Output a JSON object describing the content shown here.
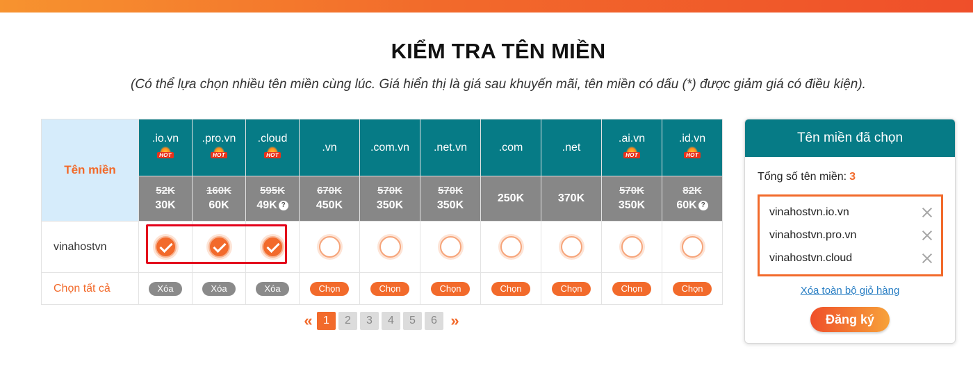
{
  "header": {
    "title": "KIỂM TRA TÊN MIỀN",
    "subtitle": "(Có thể lựa chọn nhiều tên miền cùng lúc. Giá hiển thị là giá sau khuyến mãi, tên miền có dấu (*) được giảm giá có điều kiện)."
  },
  "table": {
    "corner_label": "Tên miền",
    "hot_label": "HOT",
    "help_icon": "question-circle-icon",
    "tlds": [
      {
        "name": ".io.vn",
        "hot": true,
        "old_price": "52K",
        "price": "30K",
        "help": false,
        "checked": true,
        "action": "Xóa"
      },
      {
        "name": ".pro.vn",
        "hot": true,
        "old_price": "160K",
        "price": "60K",
        "help": false,
        "checked": true,
        "action": "Xóa"
      },
      {
        "name": ".cloud",
        "hot": true,
        "old_price": "595K",
        "price": "49K",
        "help": true,
        "checked": true,
        "action": "Xóa"
      },
      {
        "name": ".vn",
        "hot": false,
        "old_price": "670K",
        "price": "450K",
        "help": false,
        "checked": false,
        "action": "Chọn"
      },
      {
        "name": ".com.vn",
        "hot": false,
        "old_price": "570K",
        "price": "350K",
        "help": false,
        "checked": false,
        "action": "Chọn"
      },
      {
        "name": ".net.vn",
        "hot": false,
        "old_price": "570K",
        "price": "350K",
        "help": false,
        "checked": false,
        "action": "Chọn"
      },
      {
        "name": ".com",
        "hot": false,
        "old_price": "",
        "price": "250K",
        "help": false,
        "checked": false,
        "action": "Chọn"
      },
      {
        "name": ".net",
        "hot": false,
        "old_price": "",
        "price": "370K",
        "help": false,
        "checked": false,
        "action": "Chọn"
      },
      {
        "name": ".ai.vn",
        "hot": true,
        "old_price": "570K",
        "price": "350K",
        "help": false,
        "checked": false,
        "action": "Chọn"
      },
      {
        "name": ".id.vn",
        "hot": true,
        "old_price": "82K",
        "price": "60K",
        "help": true,
        "checked": false,
        "action": "Chọn"
      }
    ],
    "domain_name": "vinahostvn",
    "select_all_label": "Chọn tất cả"
  },
  "pagination": {
    "prev": "«",
    "next": "»",
    "pages": [
      "1",
      "2",
      "3",
      "4",
      "5",
      "6"
    ],
    "active": "1"
  },
  "cart": {
    "title": "Tên miền đã chọn",
    "total_label": "Tổng số tên miền:",
    "total_count": "3",
    "items": [
      "vinahostvn.io.vn",
      "vinahostvn.pro.vn",
      "vinahostvn.cloud"
    ],
    "clear_label": "Xóa toàn bộ giỏ hàng",
    "register_label": "Đăng ký"
  },
  "colors": {
    "accent": "#f26a2b",
    "header_teal": "#067b86",
    "price_gray": "#878787",
    "highlight_red": "#e3001b"
  }
}
